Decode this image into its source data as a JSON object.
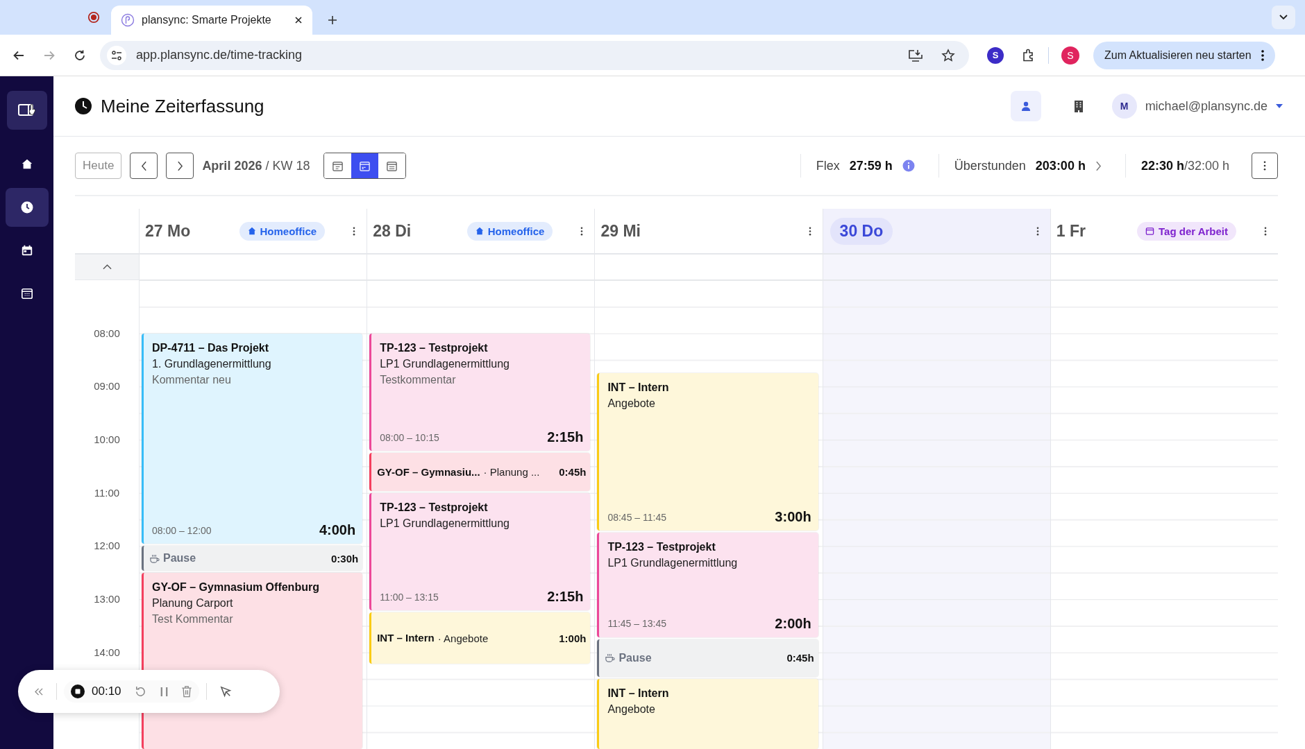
{
  "browser": {
    "tab_title": "plansync: Smarte Projekte",
    "url": "app.plansync.de/time-tracking",
    "update_button": "Zum Aktualisieren neu starten",
    "profile_letter": "S",
    "extension_letter": "S"
  },
  "sidebar": {
    "items": [
      {
        "kind": "home",
        "selected": false
      },
      {
        "kind": "clock",
        "selected": true
      },
      {
        "kind": "calendar",
        "selected": false
      },
      {
        "kind": "grid",
        "selected": false
      }
    ]
  },
  "header": {
    "title": "Meine Zeiterfassung",
    "avatar": "M",
    "email": "michael@plansync.de",
    "person_selected": true
  },
  "toolbar": {
    "today": "Heute",
    "period": "**April 2026** / KW 18",
    "views": [
      {
        "kind": "day",
        "selected": false
      },
      {
        "kind": "week",
        "selected": true
      },
      {
        "kind": "month",
        "selected": false
      }
    ],
    "flex_label": "Flex",
    "flex_value": "27:59 h",
    "overtime_label": "Überstunden",
    "overtime_value": "203:00 h",
    "week_total": "**22:30 h**/32:00 h"
  },
  "hours": [
    "08:00",
    "09:00",
    "10:00",
    "11:00",
    "12:00",
    "13:00",
    "14:00"
  ],
  "days": [
    {
      "label": "27 Mo",
      "today": false,
      "badge": {
        "kind": "homeoffice",
        "label": "Homeoffice"
      },
      "events": [
        {
          "kind": "entry",
          "color": "#38bdf8",
          "title": "DP-4711 – Das Projekt",
          "subtitle": "1. Grundlagenermittlung",
          "comment": "Kommentar neu",
          "time": "08:00 – 12:00",
          "duration": "4:00h"
        },
        {
          "kind": "pause",
          "color": "#6b7280",
          "title": "Pause",
          "duration": "0:30h"
        },
        {
          "kind": "entry",
          "color": "#f43f5e",
          "title": "GY-OF – Gymnasium Offenburg",
          "subtitle": "Planung Carport",
          "comment": "Test Kommentar"
        }
      ]
    },
    {
      "label": "28 Di",
      "today": false,
      "badge": {
        "kind": "homeoffice",
        "label": "Homeoffice"
      },
      "events": [
        {
          "kind": "entry",
          "color": "#ec4899",
          "title": "TP-123 – Testprojekt",
          "subtitle": "LP1 Grundlagenermittlung",
          "comment": "Testkommentar",
          "time": "08:00 – 10:15",
          "duration": "2:15h"
        },
        {
          "kind": "compact",
          "color": "#f43f5e",
          "title": "GY-OF – Gymnasiu...",
          "subtitle": "· Planung ...",
          "duration": "0:45h"
        },
        {
          "kind": "entry",
          "color": "#ec4899",
          "title": "TP-123 – Testprojekt",
          "subtitle": "LP1 Grundlagenermittlung",
          "time": "11:00 – 13:15",
          "duration": "2:15h"
        },
        {
          "kind": "compact",
          "color": "#facc15",
          "title": "INT – Intern",
          "subtitle": "· Angebote",
          "duration": "1:00h"
        }
      ]
    },
    {
      "label": "29 Mi",
      "today": false,
      "events": [
        {
          "kind": "entry",
          "color": "#facc15",
          "title": "INT – Intern",
          "subtitle": "Angebote",
          "time": "08:45 – 11:45",
          "duration": "3:00h"
        },
        {
          "kind": "entry",
          "color": "#ec4899",
          "title": "TP-123 – Testprojekt",
          "subtitle": "LP1 Grundlagenermittlung",
          "time": "11:45 – 13:45",
          "duration": "2:00h"
        },
        {
          "kind": "pause",
          "color": "#6b7280",
          "title": "Pause",
          "duration": "0:45h"
        },
        {
          "kind": "entry",
          "color": "#facc15",
          "title": "INT – Intern",
          "subtitle": "Angebote"
        }
      ]
    },
    {
      "label": "30 Do",
      "today": true
    },
    {
      "label": "1 Fr",
      "today": false,
      "badge": {
        "kind": "holiday",
        "label": "Tag der Arbeit"
      }
    }
  ],
  "recorder": {
    "time": "00:10"
  }
}
